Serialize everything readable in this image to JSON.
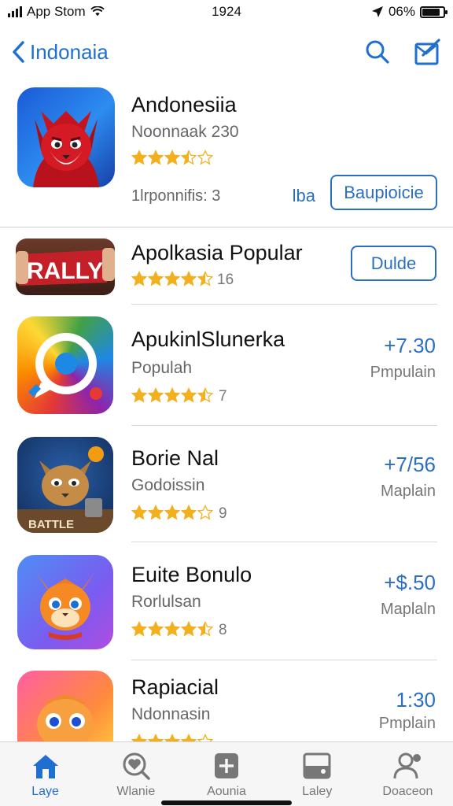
{
  "status_bar": {
    "carrier": "App Stom",
    "time": "1924",
    "battery_text": "06%",
    "battery_level": 0.85,
    "icons": [
      "signal-icon",
      "wifi-icon",
      "location-icon",
      "battery-icon"
    ]
  },
  "nav": {
    "back_label": "Indonaia",
    "icons": [
      "chevron-left-icon",
      "search-icon",
      "compose-icon"
    ]
  },
  "featured": {
    "name": "Andonesiia",
    "subtitle": "Noonnaak 230",
    "rating": 3.5,
    "meta": "1lrponnifis: 3",
    "link": "lba",
    "button": "Baupioicie"
  },
  "apps": [
    {
      "name": "Apolkasia Popular",
      "rating": 4.5,
      "count": "16",
      "button": "Dulde"
    },
    {
      "name": "ApukinlSlunerka",
      "subtitle": "Populah",
      "rating": 4.5,
      "count": "7",
      "price": "+7.30",
      "price_label": "Pmpulain"
    },
    {
      "name": "Borie Nal",
      "subtitle": "Godoissin",
      "rating": 4,
      "count": "9",
      "price": "+7/56",
      "price_label": "Maplain"
    },
    {
      "name": "Euite Bonulo",
      "subtitle": "Rorlulsan",
      "rating": 4.5,
      "count": "8",
      "price": "+$.50",
      "price_label": "Maplaln"
    },
    {
      "name": "Rapiacial",
      "subtitle": "Ndonnasin",
      "rating": 4,
      "count": "",
      "price": "1:30",
      "price_label": "Pmplain"
    }
  ],
  "icon_badges": {
    "rally": "RALLY",
    "battle": "BATTLE"
  },
  "tabs": [
    {
      "label": "Laye",
      "icon": "home-icon",
      "active": true
    },
    {
      "label": "Wlanie",
      "icon": "heart-search-icon",
      "active": false
    },
    {
      "label": "Aounia",
      "icon": "plus-square-icon",
      "active": false
    },
    {
      "label": "Laley",
      "icon": "tray-icon",
      "active": false
    },
    {
      "label": "Doaceon",
      "icon": "person-icon",
      "active": false
    }
  ],
  "colors": {
    "accent": "#1f6fd1",
    "star": "#f2b01e",
    "price": "#2a6fc0"
  }
}
